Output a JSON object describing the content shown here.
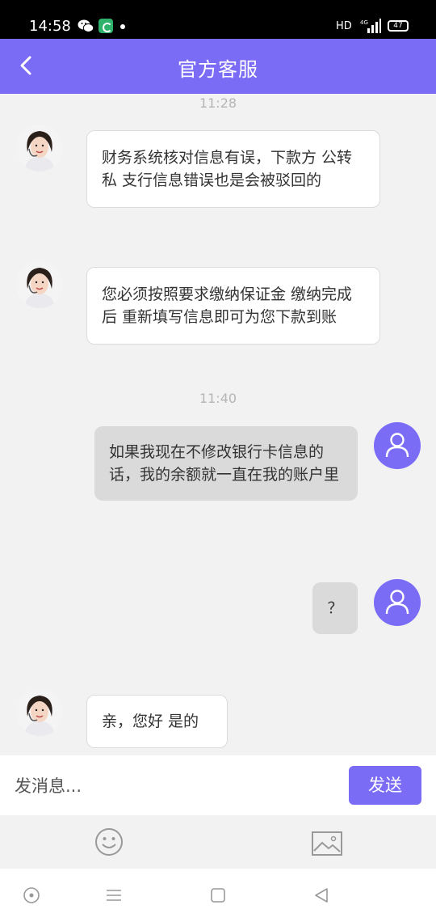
{
  "status_bar": {
    "time": "14:58",
    "network": "HD",
    "battery": "47"
  },
  "header": {
    "title": "官方客服"
  },
  "messages": [
    {
      "type": "timestamp",
      "text": "11:28"
    },
    {
      "type": "message",
      "sender": "agent",
      "text": "财务系统核对信息有误，下款方 公转私  支行信息错误也是会被驳回的"
    },
    {
      "type": "message",
      "sender": "agent",
      "text": "您必须按照要求缴纳保证金 缴纳完成后 重新填写信息即可为您下款到账"
    },
    {
      "type": "timestamp",
      "text": "11:40"
    },
    {
      "type": "message",
      "sender": "user",
      "text": "如果我现在不修改银行卡信息的话，我的余额就一直在我的账户里"
    },
    {
      "type": "message",
      "sender": "user",
      "text": "？"
    },
    {
      "type": "message",
      "sender": "agent",
      "text": "亲，您好  是的"
    }
  ],
  "composer": {
    "placeholder": "发消息...",
    "value": "",
    "send_label": "发送"
  },
  "toolbar": {
    "emoji_icon": "emoji-icon",
    "image_icon": "image-icon"
  },
  "navbar": {
    "icons": [
      "circle-nav-icon",
      "menu-nav-icon",
      "home-nav-icon",
      "back-nav-icon"
    ]
  },
  "colors": {
    "accent": "#7b6cf6",
    "agent_bubble": "#ffffff",
    "user_bubble": "#dadada"
  }
}
